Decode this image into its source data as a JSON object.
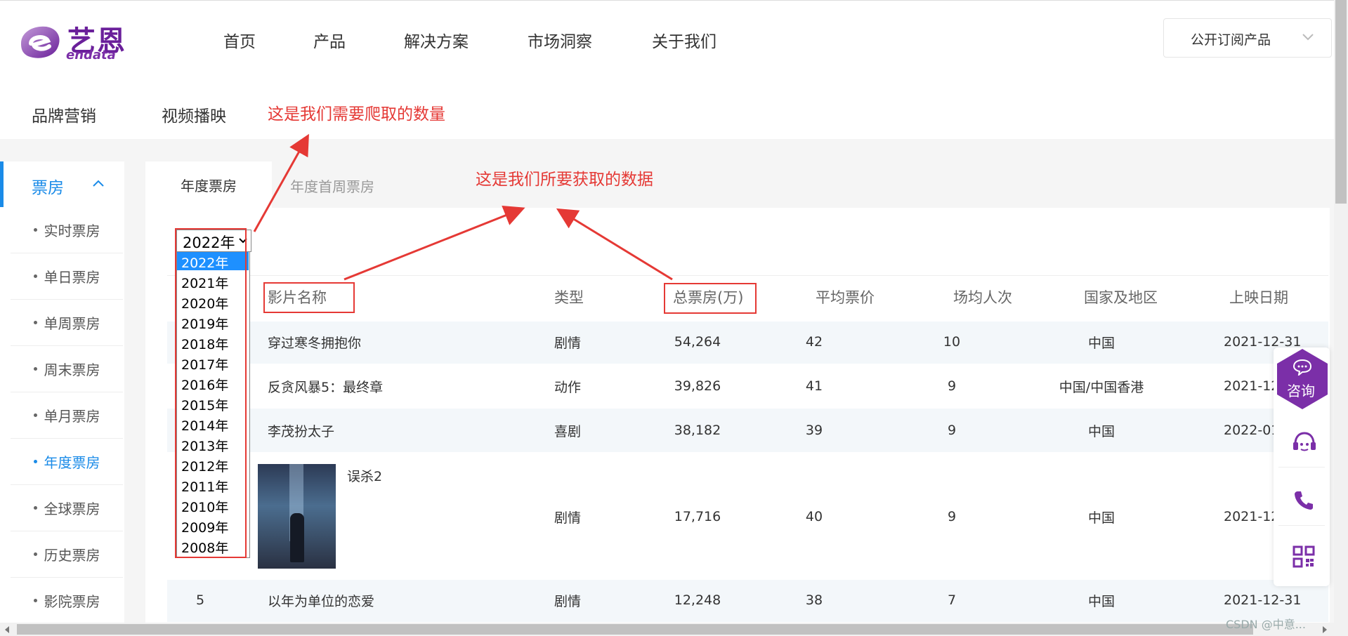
{
  "header": {
    "logo": {
      "cn": "艺恩",
      "en": "endata"
    },
    "nav": [
      "首页",
      "产品",
      "解决方案",
      "市场洞察",
      "关于我们"
    ],
    "subscribe": "公开订阅产品"
  },
  "subnav": [
    "品牌营销",
    "视频播映"
  ],
  "annotations": {
    "count_note": "这是我们需要爬取的数量",
    "data_note": "这是我们所要获取的数据"
  },
  "sidebar": {
    "header": "票房",
    "items": [
      "实时票房",
      "单日票房",
      "单周票房",
      "周末票房",
      "单月票房",
      "年度票房",
      "全球票房",
      "历史票房",
      "影院票房"
    ],
    "active": "年度票房"
  },
  "tabs": {
    "active": "年度票房",
    "inactive": "年度首周票房"
  },
  "year_select": {
    "selected": "2022年",
    "options": [
      "2022年",
      "2021年",
      "2020年",
      "2019年",
      "2018年",
      "2017年",
      "2016年",
      "2015年",
      "2014年",
      "2013年",
      "2012年",
      "2011年",
      "2010年",
      "2009年",
      "2008年"
    ]
  },
  "table": {
    "columns": [
      "影片名称",
      "类型",
      "总票房(万)",
      "平均票价",
      "场均人次",
      "国家及地区",
      "上映日期"
    ],
    "rows": [
      {
        "rank": "",
        "name": "穿过寒冬拥抱你",
        "type": "剧情",
        "total": "54,264",
        "price": "42",
        "avg": "10",
        "region": "中国",
        "date": "2021-12-31"
      },
      {
        "rank": "",
        "name": "反贪风暴5：最终章",
        "type": "动作",
        "total": "39,826",
        "price": "41",
        "avg": "9",
        "region": "中国/中国香港",
        "date": "2021-12"
      },
      {
        "rank": "",
        "name": "李茂扮太子",
        "type": "喜剧",
        "total": "38,182",
        "price": "39",
        "avg": "9",
        "region": "中国",
        "date": "2022-01"
      },
      {
        "rank": "",
        "name": "误杀2",
        "type": "剧情",
        "total": "17,716",
        "price": "40",
        "avg": "9",
        "region": "中国",
        "date": "2021-12"
      },
      {
        "rank": "5",
        "name": "以年为单位的恋爱",
        "type": "剧情",
        "total": "12,248",
        "price": "38",
        "avg": "7",
        "region": "中国",
        "date": "2021-12-31"
      }
    ]
  },
  "float_bar": {
    "consult": "咨询"
  },
  "watermark": "CSDN @中意..."
}
